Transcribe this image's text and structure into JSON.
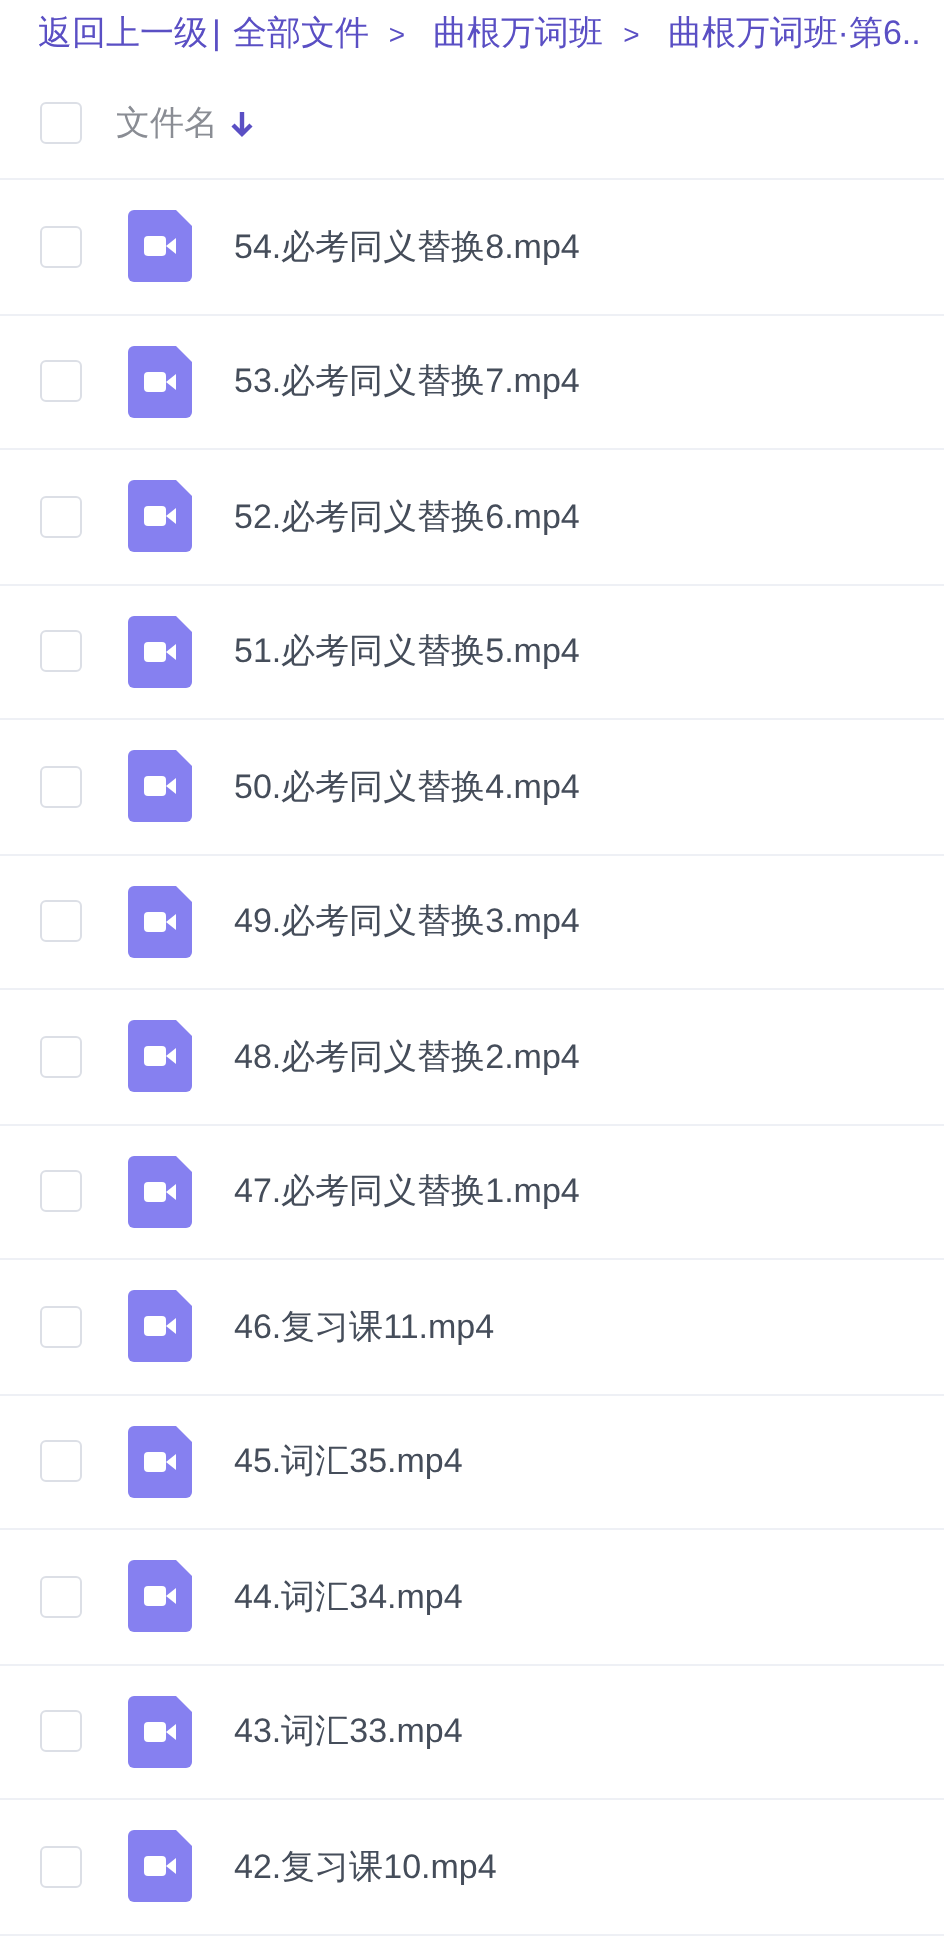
{
  "breadcrumb": {
    "back": "返回上一级",
    "separator": "|",
    "items": [
      {
        "label": "全部文件"
      },
      {
        "label": "曲根万词班"
      },
      {
        "label": "曲根万词班·第6.."
      }
    ],
    "arrow": ">"
  },
  "header": {
    "checked": false,
    "column": "文件名"
  },
  "files": [
    {
      "name": "54.必考同义替换8.mp4",
      "checked": false
    },
    {
      "name": "53.必考同义替换7.mp4",
      "checked": false
    },
    {
      "name": "52.必考同义替换6.mp4",
      "checked": false
    },
    {
      "name": "51.必考同义替换5.mp4",
      "checked": false
    },
    {
      "name": "50.必考同义替换4.mp4",
      "checked": false
    },
    {
      "name": "49.必考同义替换3.mp4",
      "checked": false
    },
    {
      "name": "48.必考同义替换2.mp4",
      "checked": false
    },
    {
      "name": "47.必考同义替换1.mp4",
      "checked": false
    },
    {
      "name": "46.复习课11.mp4",
      "checked": false
    },
    {
      "name": "45.词汇35.mp4",
      "checked": false
    },
    {
      "name": "44.词汇34.mp4",
      "checked": false
    },
    {
      "name": "43.词汇33.mp4",
      "checked": false
    },
    {
      "name": "42.复习课10.mp4",
      "checked": false
    }
  ]
}
